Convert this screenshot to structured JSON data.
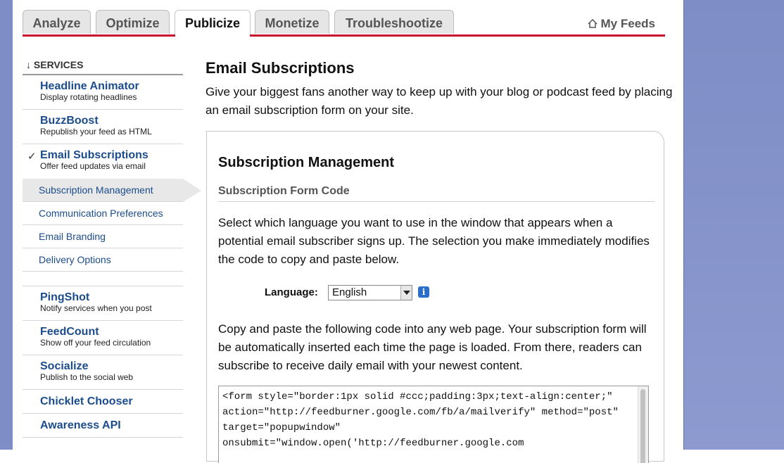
{
  "tabs": [
    {
      "label": "Analyze"
    },
    {
      "label": "Optimize"
    },
    {
      "label": "Publicize"
    },
    {
      "label": "Monetize"
    },
    {
      "label": "Troubleshootize"
    }
  ],
  "active_tab": "Publicize",
  "my_feeds_label": "My Feeds",
  "sidebar": {
    "header": "↓ SERVICES",
    "check_mark": "✓",
    "services": [
      {
        "name": "Headline Animator",
        "desc": "Display rotating headlines"
      },
      {
        "name": "BuzzBoost",
        "desc": "Republish your feed as HTML"
      },
      {
        "name": "Email Subscriptions",
        "desc": "Offer feed updates via email"
      },
      {
        "name": "PingShot",
        "desc": "Notify services when you post"
      },
      {
        "name": "FeedCount",
        "desc": "Show off your feed circulation"
      },
      {
        "name": "Socialize",
        "desc": "Publish to the social web"
      },
      {
        "name": "Chicklet Chooser",
        "desc": ""
      },
      {
        "name": "Awareness API",
        "desc": ""
      }
    ],
    "sub_items": [
      {
        "label": "Subscription Management"
      },
      {
        "label": "Communication Preferences"
      },
      {
        "label": "Email Branding"
      },
      {
        "label": "Delivery Options"
      }
    ]
  },
  "main": {
    "title": "Email Subscriptions",
    "intro": "Give your biggest fans another way to keep up with your blog or podcast feed by placing an email subscription form on your site.",
    "panel_title": "Subscription Management",
    "panel_subtitle": "Subscription Form Code",
    "language_instructions": "Select which language you want to use in the window that appears when a potential email subscriber signs up. The selection you make immediately modifies the code to copy and paste below.",
    "language_label": "Language:",
    "language_value": "English",
    "info_icon_text": "i",
    "copy_instructions": "Copy and paste the following code into any web page. Your subscription form will be automatically inserted each time the page is loaded. From there, readers can subscribe to receive daily email with your newest content.",
    "code": "<form style=\"border:1px solid #ccc;padding:3px;text-align:center;\"\naction=\"http://feedburner.google.com/fb/a/mailverify\" method=\"post\"\ntarget=\"popupwindow\"\nonsubmit=\"window.open('http://feedburner.google.com"
  }
}
